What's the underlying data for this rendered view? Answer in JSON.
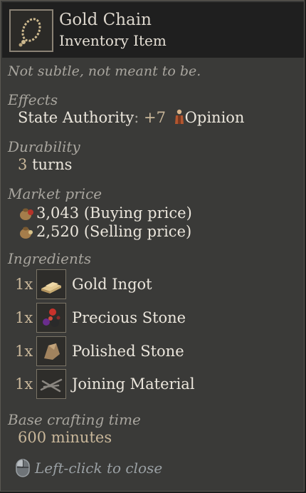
{
  "header": {
    "title": "Gold Chain",
    "subtitle": "Inventory Item",
    "icon": "gold-chain-icon"
  },
  "flavor_text": "Not subtle, not meant to be.",
  "effects": {
    "heading": "Effects",
    "name": "State Authority",
    "separator": ":",
    "value": "+7",
    "target": "Opinion",
    "icon": "character-icon"
  },
  "durability": {
    "heading": "Durability",
    "value": "3",
    "unit": "turns"
  },
  "market_price": {
    "heading": "Market price",
    "buy_value": "3,043",
    "buy_label": "(Buying price)",
    "sell_value": "2,520",
    "sell_label": "(Selling price)"
  },
  "ingredients": {
    "heading": "Ingredients",
    "items": [
      {
        "qty": "1x",
        "name": "Gold Ingot",
        "icon": "gold-ingot-icon"
      },
      {
        "qty": "1x",
        "name": "Precious Stone",
        "icon": "precious-stone-icon"
      },
      {
        "qty": "1x",
        "name": "Polished Stone",
        "icon": "polished-stone-icon"
      },
      {
        "qty": "1x",
        "name": "Joining Material",
        "icon": "joining-material-icon"
      }
    ]
  },
  "crafting": {
    "heading": "Base crafting time",
    "value": "600",
    "unit": "minutes"
  },
  "footer": {
    "close_hint": "Left-click to close",
    "icon": "mouse-icon"
  },
  "colors": {
    "background": "#3a3a38",
    "header_bg": "#1f1f1f",
    "text": "#ebe6dc",
    "heading": "#a8a59e",
    "number": "#c9b79a"
  }
}
